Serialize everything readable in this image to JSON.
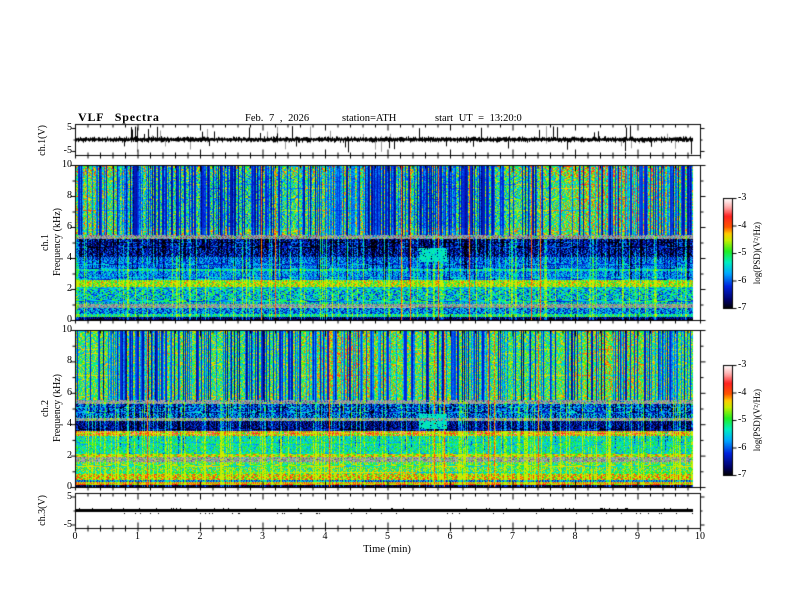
{
  "header": {
    "title": "VLF Spectra",
    "date": "Feb. 7 , 2026",
    "station": "station=ATH",
    "start_ut": "start UT =  13:20:0"
  },
  "panels": {
    "ch1_wave": {
      "ylabel": "ch.1(V)",
      "yticks": [
        "5",
        "-5"
      ]
    },
    "spec1": {
      "ylabel_line1": "ch.1",
      "ylabel_line2": "Frequency (kHz)",
      "yticks": [
        "10",
        "8",
        "6",
        "4",
        "2",
        "0"
      ]
    },
    "spec2": {
      "ylabel_line1": "ch.2",
      "ylabel_line2": "Frequency (kHz)",
      "yticks": [
        "10",
        "8",
        "6",
        "4",
        "2",
        "0"
      ]
    },
    "ch3_wave": {
      "ylabel": "ch.3(V)",
      "yticks": [
        "5",
        "-5"
      ]
    }
  },
  "xaxis": {
    "label": "Time (min)",
    "ticks": [
      "0",
      "1",
      "2",
      "3",
      "4",
      "5",
      "6",
      "7",
      "8",
      "9",
      "10"
    ]
  },
  "colorbar": {
    "label": "log(PSD)(V²/Hz)",
    "ticks": [
      "-3",
      "-4",
      "-5",
      "-6",
      "-7"
    ]
  },
  "chart_data": {
    "type": "heatmap",
    "title": "VLF Spectra",
    "date": "Feb. 7 , 2026",
    "station": "ATH",
    "start_ut": "13:20:0",
    "x_axis": {
      "label": "Time (min)",
      "range": [
        0,
        10
      ],
      "major_tick_min": 1,
      "minor_tick_min": 0.2,
      "data_end_min": 9.8
    },
    "colorbar_range": {
      "top": -3,
      "bottom": -7,
      "label": "log(PSD)(V²/Hz)"
    },
    "palette_stops": [
      [
        -7.0,
        "#000000"
      ],
      [
        -6.72,
        "#000060"
      ],
      [
        -6.2,
        "#0022dd"
      ],
      [
        -5.72,
        "#00aaff"
      ],
      [
        -5.32,
        "#00eec0"
      ],
      [
        -4.92,
        "#22ee22"
      ],
      [
        -4.52,
        "#c8ee00"
      ],
      [
        -4.28,
        "#ffcc00"
      ],
      [
        -4.04,
        "#ff5500"
      ],
      [
        -3.64,
        "#ff2222"
      ],
      [
        -3.32,
        "#ffaaaa"
      ],
      [
        -3.0,
        "#ffffff"
      ]
    ],
    "panels": [
      {
        "name": "ch1_waveform",
        "type": "line",
        "ylabel": "ch.1(V)",
        "y_range": [
          -6,
          6
        ],
        "y_ticks": [
          5,
          -5
        ],
        "character": "zero-mean broadband noise ~0.5 V with impulsive spikes to +/-5 V",
        "noise_v": 0.9,
        "spike_prob": 0.07,
        "grey_spike_prob": 0.05,
        "seed": 11
      },
      {
        "name": "ch1_spectrogram",
        "type": "heatmap",
        "ylabel": "ch.1 Frequency (kHz)",
        "f_range": [
          0,
          10
        ],
        "z_range": [
          -7,
          -3
        ],
        "seed": 101,
        "patch_amp": 0.55,
        "streaks": {
          "dark": 0.62,
          "cyan": 0.2,
          "orange": 0.012,
          "black": 0.035
        },
        "blob": {
          "x_min": [
            5.5,
            5.95
          ],
          "f": [
            3.75,
            4.65
          ],
          "level": -5.35
        },
        "bands": [
          {
            "f": [
              9.35,
              10
            ],
            "level": -4.55,
            "noise": 0.5
          },
          {
            "f": [
              5.5,
              9.35
            ],
            "level": -4.8,
            "noise": 0.45
          },
          {
            "f": [
              5.28,
              5.5
            ],
            "level": -5.0,
            "noise": 0.3,
            "grey": true,
            "red_speck": true
          },
          {
            "f": [
              4.1,
              5.28
            ],
            "level": -6.45,
            "noise": 0.35
          },
          {
            "f": [
              3.32,
              4.1
            ],
            "level": -5.95,
            "noise": 0.3
          },
          {
            "f": [
              3.15,
              3.32
            ],
            "level": -5.3,
            "noise": 0.25
          },
          {
            "f": [
              2.58,
              3.15
            ],
            "level": -5.8,
            "noise": 0.3
          },
          {
            "f": [
              2.15,
              2.58
            ],
            "level": -4.6,
            "noise": 0.3
          },
          {
            "f": [
              1.95,
              2.15
            ],
            "level": -5.5,
            "noise": 0.3
          },
          {
            "f": [
              1.05,
              1.95
            ],
            "level": -5.55,
            "noise": 0.4
          },
          {
            "f": [
              0.75,
              1.05
            ],
            "level": -5.15,
            "noise": 0.3,
            "grey": true
          },
          {
            "f": [
              0.42,
              0.75
            ],
            "level": -5.9,
            "noise": 0.35
          },
          {
            "f": [
              0.2,
              0.42
            ],
            "level": -5.25,
            "noise": 0.3
          },
          {
            "f": [
              0.06,
              0.2
            ],
            "level": -6.6,
            "noise": 0.25
          },
          {
            "f": [
              0,
              0.06
            ],
            "level": -6.9,
            "noise": 0.1
          }
        ]
      },
      {
        "name": "ch2_spectrogram",
        "type": "heatmap",
        "ylabel": "ch.2 Frequency (kHz)",
        "f_range": [
          0,
          10
        ],
        "z_range": [
          -7,
          -3
        ],
        "seed": 202,
        "patch_amp": 0.3,
        "streaks": {
          "dark": 0.55,
          "cyan": 0.22,
          "orange": 0.015,
          "black": 0.03
        },
        "blob": {
          "x_min": [
            5.5,
            5.95
          ],
          "f": [
            3.75,
            4.65
          ],
          "level": -5.35
        },
        "bands": [
          {
            "f": [
              5.55,
              10
            ],
            "level": -4.85,
            "noise": 0.4
          },
          {
            "f": [
              5.3,
              5.55
            ],
            "level": -5.0,
            "noise": 0.3,
            "grey": true
          },
          {
            "f": [
              4.42,
              5.3
            ],
            "level": -6.05,
            "noise": 0.4
          },
          {
            "f": [
              4.25,
              4.42
            ],
            "level": -5.1,
            "noise": 0.3,
            "grey": true
          },
          {
            "f": [
              3.58,
              4.25
            ],
            "level": -6.55,
            "noise": 0.3
          },
          {
            "f": [
              3.3,
              3.58
            ],
            "level": -4.15,
            "noise": 0.45
          },
          {
            "f": [
              2.12,
              3.3
            ],
            "level": -5.3,
            "noise": 0.3
          },
          {
            "f": [
              1.9,
              2.12
            ],
            "level": -4.5,
            "noise": 0.3
          },
          {
            "f": [
              1.58,
              1.9
            ],
            "level": -5.05,
            "noise": 0.3,
            "grey": true
          },
          {
            "f": [
              0.82,
              1.58
            ],
            "level": -4.95,
            "noise": 0.4
          },
          {
            "f": [
              0.48,
              0.82
            ],
            "level": -4.4,
            "noise": 0.35
          },
          {
            "f": [
              0.3,
              0.48
            ],
            "level": -5.9,
            "noise": 0.3
          },
          {
            "f": [
              0.14,
              0.3
            ],
            "level": -4.25,
            "noise": 0.3
          },
          {
            "f": [
              0,
              0.14
            ],
            "level": -6.85,
            "noise": 0.15
          }
        ]
      },
      {
        "name": "ch3_waveform",
        "type": "line",
        "ylabel": "ch.3(V)",
        "y_range": [
          -6,
          6
        ],
        "y_ticks": [
          5,
          -5
        ],
        "character": "flat line at 0 V (no signal)",
        "line_v": 0,
        "seed": 33
      }
    ]
  }
}
